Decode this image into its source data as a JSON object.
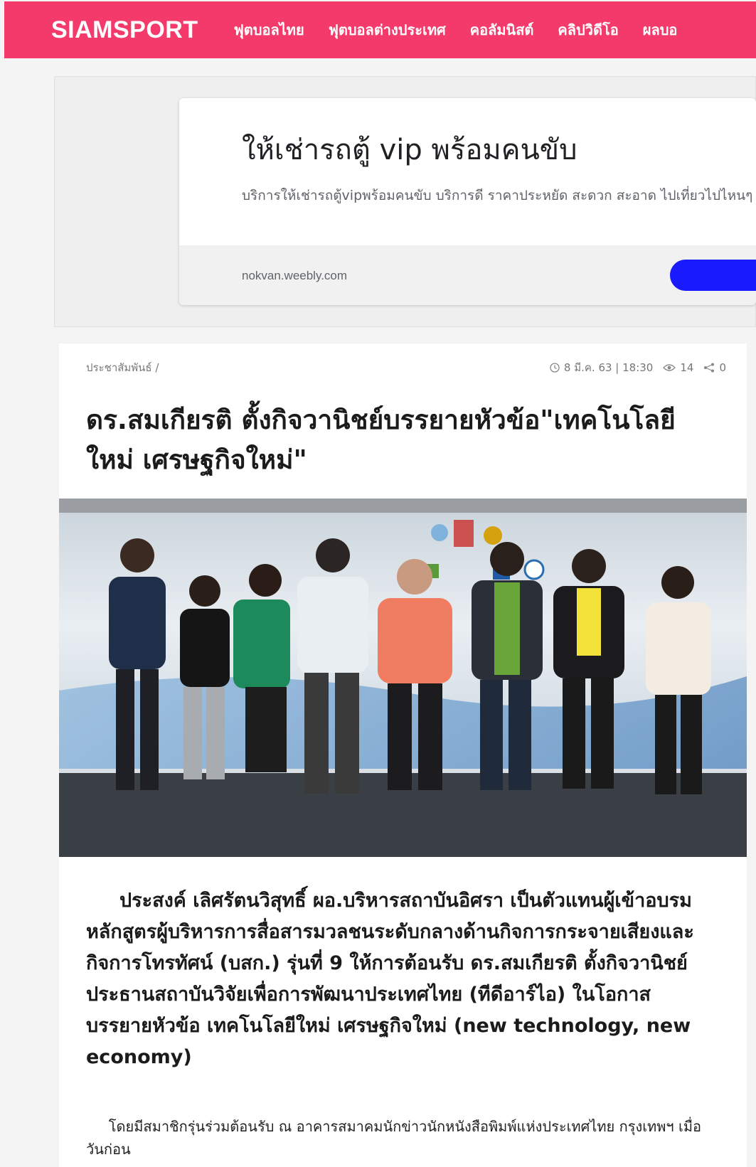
{
  "brand": {
    "color": "#f33a6a"
  },
  "header": {
    "logo": "SIAMSPORT",
    "nav": [
      "ฟุตบอลไทย",
      "ฟุตบอลต่างประเทศ",
      "คอลัมนิสต์",
      "คลิปวิดีโอ",
      "ผลบอ"
    ]
  },
  "ad": {
    "title": "ให้เช่ารถตู้ vip พร้อมคนขับ",
    "description": "บริการให้เช่ารถตู้vipพร้อมคนขับ บริการดี ราคาประหยัด สะดวก สะอาด ไปเที่ยวไปไหนๆ",
    "url": "nokvan.weebly.com",
    "button_color": "#1a1aff"
  },
  "article": {
    "breadcrumb": "ประชาสัมพันธ์  /",
    "date": "8 มี.ค. 63 | 18:30",
    "views": "14",
    "shares": "0",
    "headline": "ดร.สมเกียรติ ตั้งกิจวานิชย์บรรยายหัวข้อ\"เทคโนโลยีใหม่ เศรษฐกิจใหม่\"",
    "lead": "     ประสงค์ เลิศรัตนวิสุทธิ์ ผอ.บริหารสถาบันอิศรา เป็นตัวแทนผู้เข้าอบรมหลักสูตรผู้บริหารการสื่อสารมวลชนระดับกลางด้านกิจการกระจายเสียงและกิจการโทรทัศน์ (บสก.) รุ่นที่ 9 ให้การต้อนรับ ดร.สมเกียรติ ตั้งกิจวานิชย์ ประธานสถาบันวิจัยเพื่อการพัฒนาประเทศไทย (ทีดีอาร์ไอ) ในโอกาสบรรยายหัวข้อ เทคโนโลยีใหม่ เศรษฐกิจใหม่ (new technology, new economy)",
    "body": "     โดยมีสมาชิกรุ่นร่วมต้อนรับ ณ อาคารสมาคมนักข่าวนักหนังสือพิมพ์แห่งประเทศไทย กรุงเทพฯ เมื่อวันก่อน"
  },
  "icons": {
    "clock": "clock-icon",
    "eye": "eye-icon",
    "share": "share-icon"
  }
}
